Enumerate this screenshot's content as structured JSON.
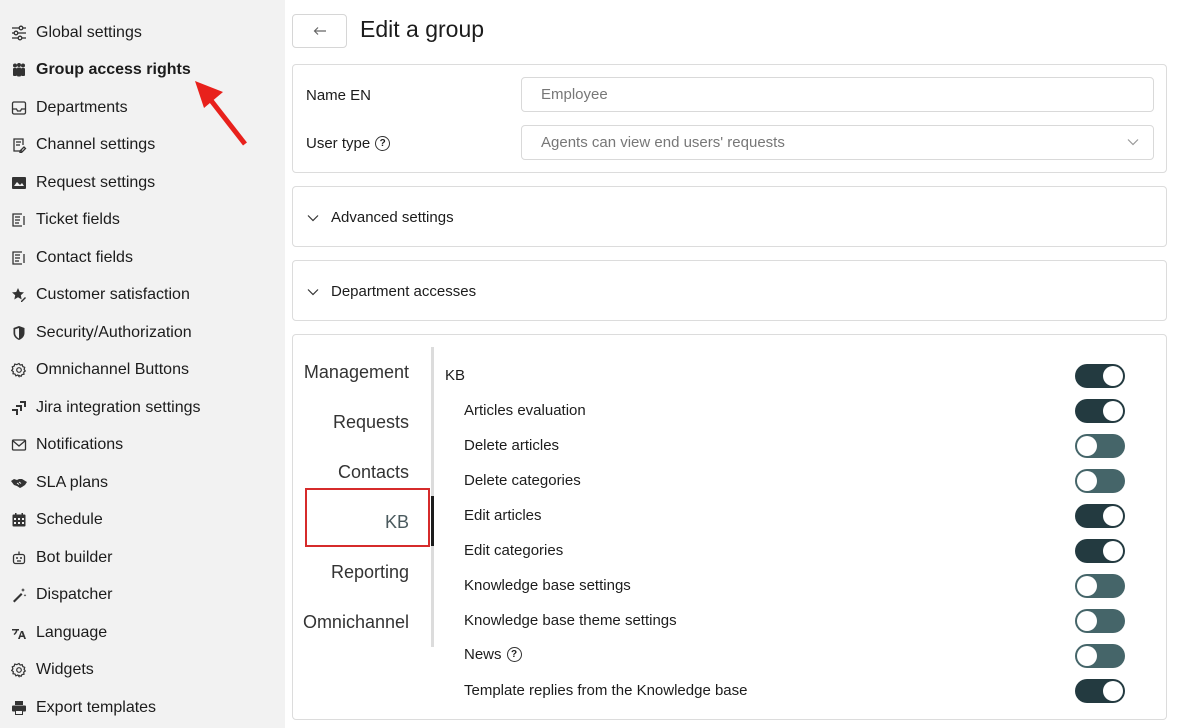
{
  "sidebar": {
    "items": [
      {
        "label": "Global settings",
        "icon": "sliders-icon"
      },
      {
        "label": "Group access rights",
        "icon": "users-icon",
        "active": true
      },
      {
        "label": "Departments",
        "icon": "inbox-icon"
      },
      {
        "label": "Channel settings",
        "icon": "document-edit-icon"
      },
      {
        "label": "Request settings",
        "icon": "image-box-icon"
      },
      {
        "label": "Ticket fields",
        "icon": "form-icon"
      },
      {
        "label": "Contact fields",
        "icon": "form-icon"
      },
      {
        "label": "Customer satisfaction",
        "icon": "star-edit-icon"
      },
      {
        "label": "Security/Authorization",
        "icon": "shield-icon"
      },
      {
        "label": "Omnichannel Buttons",
        "icon": "gear-icon"
      },
      {
        "label": "Jira integration settings",
        "icon": "jira-icon"
      },
      {
        "label": "Notifications",
        "icon": "envelope-icon"
      },
      {
        "label": "SLA plans",
        "icon": "handshake-icon"
      },
      {
        "label": "Schedule",
        "icon": "calendar-icon"
      },
      {
        "label": "Bot builder",
        "icon": "robot-icon"
      },
      {
        "label": "Dispatcher",
        "icon": "magic-wand-icon"
      },
      {
        "label": "Language",
        "icon": "language-icon"
      },
      {
        "label": "Widgets",
        "icon": "gear-icon"
      },
      {
        "label": "Export templates",
        "icon": "printer-icon"
      }
    ]
  },
  "header": {
    "back_icon": "arrow-left-icon",
    "title": "Edit a group"
  },
  "form": {
    "name_label": "Name EN",
    "name_value": "Employee",
    "user_type_label": "User type",
    "user_type_help": "?",
    "user_type_value": "Agents can view end users' requests"
  },
  "sections": {
    "advanced": "Advanced settings",
    "departments": "Department accesses"
  },
  "tabs": {
    "items": [
      "Management",
      "Requests",
      "Contacts",
      "KB",
      "Reporting",
      "Omnichannel"
    ],
    "active": "KB"
  },
  "permissions": {
    "title": "KB",
    "title_enabled": true,
    "items": [
      {
        "label": "Articles evaluation",
        "enabled": true
      },
      {
        "label": "Delete articles",
        "enabled": false
      },
      {
        "label": "Delete categories",
        "enabled": false
      },
      {
        "label": "Edit articles",
        "enabled": true
      },
      {
        "label": "Edit categories",
        "enabled": true
      },
      {
        "label": "Knowledge base settings",
        "enabled": false
      },
      {
        "label": "Knowledge base theme settings",
        "enabled": false
      },
      {
        "label": "News",
        "enabled": false,
        "help": "?"
      },
      {
        "label": "Template replies from the Knowledge base",
        "enabled": true
      }
    ]
  },
  "colors": {
    "toggle_on": "#233a40",
    "toggle_off": "#456569",
    "highlight_box": "#d62b2b",
    "annotation_arrow": "#e8211c"
  }
}
